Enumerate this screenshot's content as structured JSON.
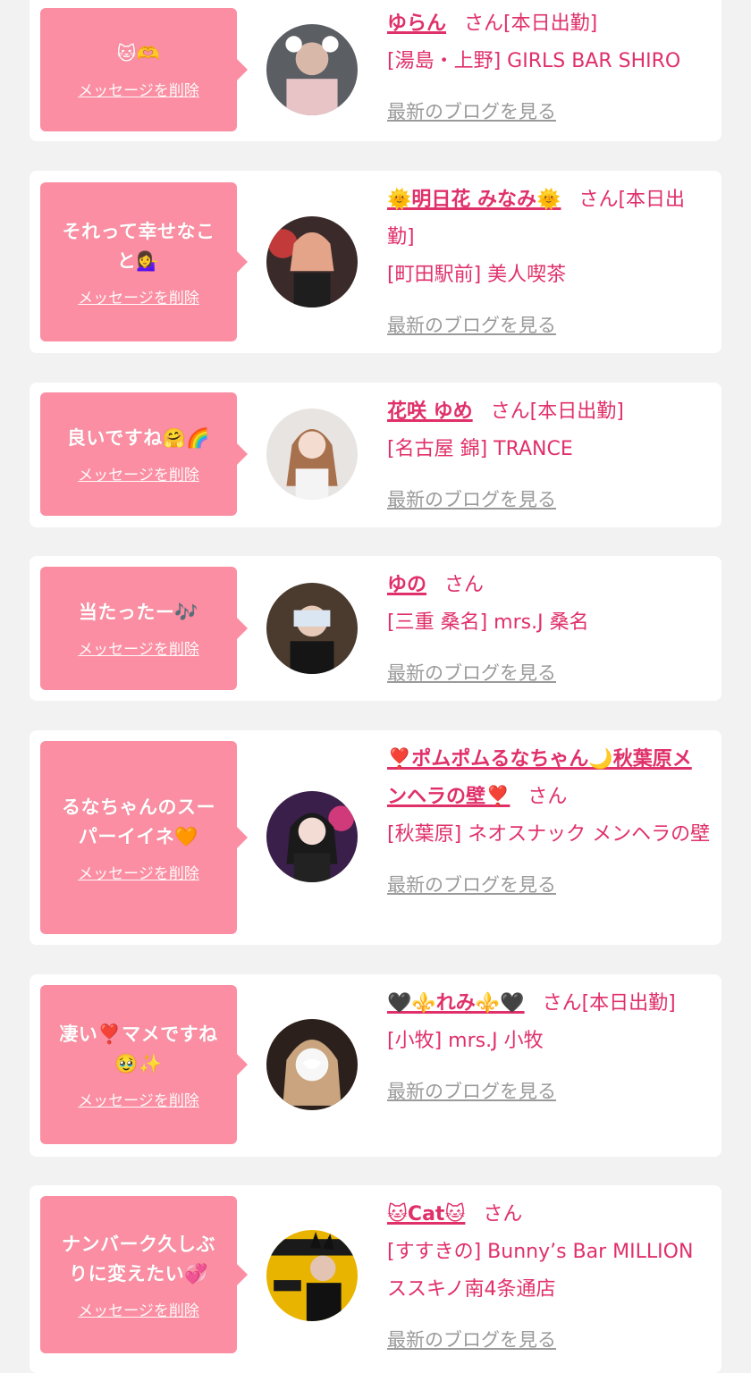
{
  "colors": {
    "accent": "#e0306a",
    "bubble": "#fb8ea2",
    "background": "#f2f2f2",
    "link_gray": "#9a9a9a"
  },
  "cards": [
    {
      "message": "🐱🫶",
      "delete_label": "メッセージを削除",
      "name": "ゆらん",
      "honorific": "さん[本日出勤]",
      "shop": "[湯島・上野] GIRLS BAR SHIRO",
      "blog_label": "最新のブログを見る",
      "avatar_icon": "user-photo-icon"
    },
    {
      "message": "それって幸せなこと💁‍♀️",
      "delete_label": "メッセージを削除",
      "name": "🌞明日花 みなみ🌞",
      "honorific": "さん[本日出勤]",
      "shop": "[町田駅前] 美人喫茶",
      "blog_label": "最新のブログを見る",
      "avatar_icon": "user-photo-icon"
    },
    {
      "message": "良いですね🤗🌈",
      "delete_label": "メッセージを削除",
      "name": "花咲 ゆめ",
      "honorific": "さん[本日出勤]",
      "shop": "[名古屋 錦] TRANCE",
      "blog_label": "最新のブログを見る",
      "avatar_icon": "user-photo-icon"
    },
    {
      "message": "当たったー🎶",
      "delete_label": "メッセージを削除",
      "name": "ゆの",
      "honorific": "さん",
      "shop": "[三重 桑名] mrs.J 桑名",
      "blog_label": "最新のブログを見る",
      "avatar_icon": "user-photo-icon"
    },
    {
      "message": "るなちゃんのスーパーイイネ🧡",
      "delete_label": "メッセージを削除",
      "name": "❣️ポムポムるなちゃん🌙秋葉原メンヘラの壁❣️",
      "honorific": "さん",
      "shop": "[秋葉原] ネオスナック メンヘラの壁",
      "blog_label": "最新のブログを見る",
      "avatar_icon": "user-photo-icon"
    },
    {
      "message": "凄い❣️マメですね🥹✨",
      "delete_label": "メッセージを削除",
      "name": "🖤⚜️れみ⚜️🖤",
      "honorific": "さん[本日出勤]",
      "shop": "[小牧] mrs.J 小牧",
      "blog_label": "最新のブログを見る",
      "avatar_icon": "user-photo-icon"
    },
    {
      "message": "ナンバーク久しぶりに変えたい💞",
      "delete_label": "メッセージを削除",
      "name": "🐱Cat🐱",
      "honorific": "さん",
      "shop": "[すすきの] Bunny’s Bar MILLION ススキノ南4条通店",
      "blog_label": "最新のブログを見る",
      "avatar_icon": "user-photo-icon"
    }
  ]
}
